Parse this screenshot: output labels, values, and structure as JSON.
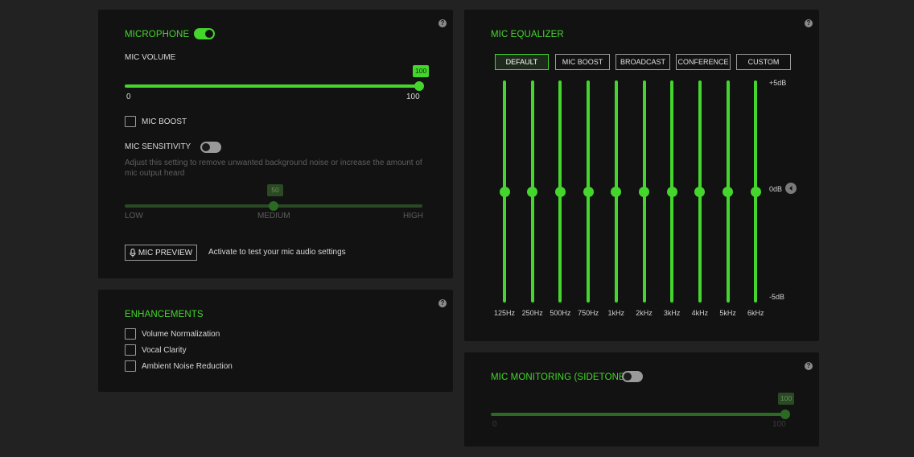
{
  "microphone": {
    "title": "MICROPHONE",
    "toggle_on": true,
    "help": "?",
    "volume": {
      "label": "MIC VOLUME",
      "value": "100",
      "min_label": "0",
      "max_label": "100",
      "level": 1.0
    },
    "mic_boost": {
      "label": "MIC BOOST",
      "checked": false
    },
    "sensitivity": {
      "label": "MIC SENSITIVITY",
      "toggle_on": false,
      "description": "Adjust this setting to remove unwanted background noise or increase the amount of mic output heard",
      "value": "50",
      "level": 0.5,
      "low_label": "LOW",
      "medium_label": "MEDIUM",
      "high_label": "HIGH"
    },
    "preview": {
      "button_label": "MIC PREVIEW",
      "hint": "Activate to test your mic audio settings"
    }
  },
  "enhancements": {
    "title": "ENHANCEMENTS",
    "help": "?",
    "items": [
      {
        "label": "Volume Normalization",
        "checked": false
      },
      {
        "label": "Vocal Clarity",
        "checked": false
      },
      {
        "label": "Ambient Noise Reduction",
        "checked": false
      }
    ]
  },
  "equalizer": {
    "title": "MIC EQUALIZER",
    "help": "?",
    "presets": [
      "DEFAULT",
      "MIC BOOST",
      "BROADCAST",
      "CONFERENCE",
      "CUSTOM"
    ],
    "active_preset": "DEFAULT",
    "db_max": "+5dB",
    "db_mid": "0dB",
    "db_min": "-5dB",
    "bands": [
      {
        "freq": "125Hz",
        "gain_db": 0
      },
      {
        "freq": "250Hz",
        "gain_db": 0
      },
      {
        "freq": "500Hz",
        "gain_db": 0
      },
      {
        "freq": "750Hz",
        "gain_db": 0
      },
      {
        "freq": "1kHz",
        "gain_db": 0
      },
      {
        "freq": "2kHz",
        "gain_db": 0
      },
      {
        "freq": "3kHz",
        "gain_db": 0
      },
      {
        "freq": "4kHz",
        "gain_db": 0
      },
      {
        "freq": "5kHz",
        "gain_db": 0
      },
      {
        "freq": "6kHz",
        "gain_db": 0
      }
    ]
  },
  "monitoring": {
    "title": "MIC MONITORING (SIDETONE)",
    "help": "?",
    "toggle_on": false,
    "value": "100",
    "level": 1.0,
    "min_label": "0",
    "max_label": "100"
  },
  "colors": {
    "accent": "#44d62c",
    "accent_dim": "#2a6a22",
    "panel": "#121212",
    "background": "#222222"
  }
}
